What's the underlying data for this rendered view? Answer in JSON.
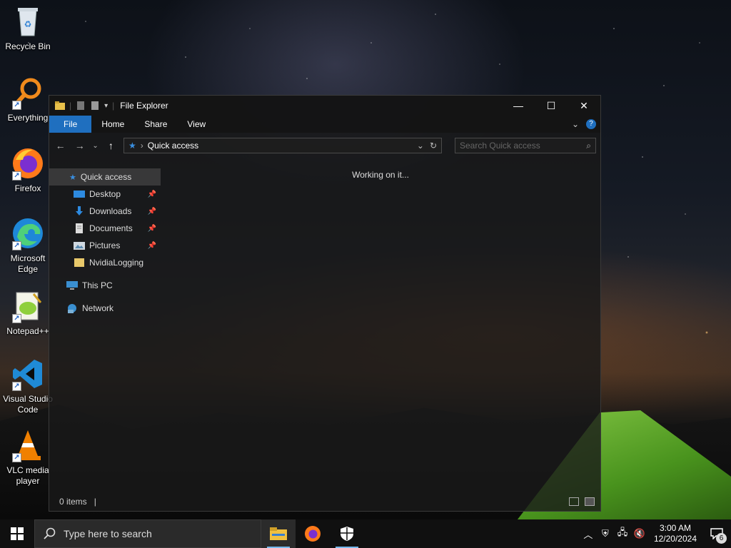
{
  "desktop": {
    "icons": [
      {
        "label": "Recycle Bin"
      },
      {
        "label": "Everything"
      },
      {
        "label": "Firefox"
      },
      {
        "label": "Microsoft Edge"
      },
      {
        "label": "Notepad++"
      },
      {
        "label": "Visual Studio Code"
      },
      {
        "label": "VLC media player"
      }
    ]
  },
  "explorer": {
    "title": "File Explorer",
    "ribbon_tabs": [
      "File",
      "Home",
      "Share",
      "View"
    ],
    "address": "Quick access",
    "search_placeholder": "Search Quick access",
    "nav": {
      "quick_access": "Quick access",
      "items": [
        "Desktop",
        "Downloads",
        "Documents",
        "Pictures",
        "NvidiaLogging"
      ],
      "this_pc": "This PC",
      "network": "Network"
    },
    "status_message": "Working on it...",
    "item_count": "0 items"
  },
  "taskbar": {
    "search_placeholder": "Type here to search",
    "time": "3:00 AM",
    "date": "12/20/2024",
    "notification_count": "6"
  },
  "colors": {
    "accent": "#1f6fbf",
    "taskbar": "#101010"
  }
}
